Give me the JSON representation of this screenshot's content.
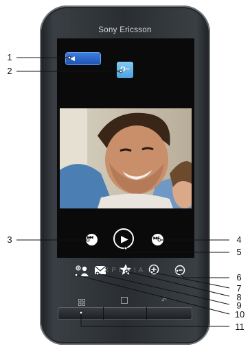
{
  "device": {
    "brand": "Sony Ericsson",
    "model": "XPERIA"
  },
  "screen": {
    "back_button_icon": "back-arrow-icon",
    "keyhole_icon": "key-icon"
  },
  "controls": {
    "previous": "previous-track-icon",
    "play": "play-icon",
    "next": "next-track-icon",
    "add_contact": "add-contact-icon",
    "message": "envelope-icon",
    "favorite": "star-icon",
    "zoom_in": "zoom-in-icon",
    "zoom_out": "zoom-out-icon"
  },
  "hardware_keys": [
    "menu-key",
    "home-key",
    "back-key"
  ],
  "callouts": {
    "c1": "1",
    "c2": "2",
    "c3": "3",
    "c4": "4",
    "c5": "5",
    "c6": "6",
    "c7": "7",
    "c8": "8",
    "c9": "9",
    "c10": "10",
    "c11": "11"
  },
  "colors": {
    "screen_blue_button": "#2a63c6",
    "light_blue_button": "#5fb2ea",
    "phone_body": "#2a2e32"
  }
}
